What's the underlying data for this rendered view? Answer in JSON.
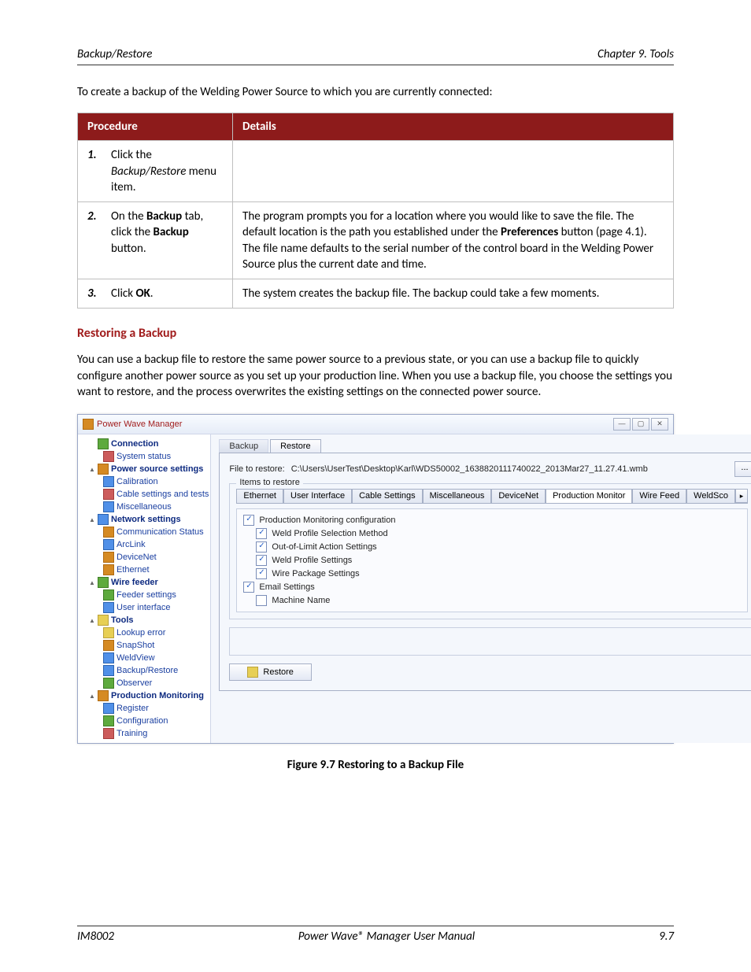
{
  "header": {
    "left": "Backup/Restore",
    "right": "Chapter 9. Tools"
  },
  "intro": "To create a backup of the Welding Power Source to which you are currently connected:",
  "table": {
    "col_procedure": "Procedure",
    "col_details": "Details",
    "rows": [
      {
        "num": "1.",
        "proc_parts": [
          "Click the ",
          "Backup/Restore",
          " menu item."
        ],
        "details": ""
      },
      {
        "num": "2.",
        "proc_parts": [
          "On the ",
          "Backup",
          " tab, click the ",
          "Backup",
          " button."
        ],
        "details_parts": [
          "The program prompts you for a location where you would like to save the file.  The default location is the path you established under the ",
          "Preferences",
          " button (page 4.1).  The file name defaults to the serial number of the control board in the Welding Power Source plus the current date and time."
        ]
      },
      {
        "num": "3.",
        "proc_parts": [
          "Click ",
          "OK",
          "."
        ],
        "details": "The system creates the backup file.  The backup could take a few moments."
      }
    ]
  },
  "h2": "Restoring a Backup",
  "para": "You can use a backup file to restore the same power source to a previous state, or you can use a backup file to quickly configure another power source as you set up your production line.  When you use a backup file, you choose the settings you want to restore, and the process overwrites the existing settings on the connected power source.",
  "figcap": "Figure 9.7    Restoring to a Backup File",
  "footer": {
    "left": "IM8002",
    "center": "Power Wave® Manager User Manual",
    "right": "9.7"
  },
  "app": {
    "title": "Power Wave Manager",
    "winbtns": {
      "min": "—",
      "max": "▢",
      "close": "✕"
    },
    "tree": [
      {
        "lvl": 0,
        "label": "Connection",
        "bold": true,
        "icon": "ico-green",
        "tri": ""
      },
      {
        "lvl": 1,
        "label": "System status",
        "icon": "ico-red"
      },
      {
        "lvl": 0,
        "label": "Power source settings",
        "bold": true,
        "icon": "ico-generic",
        "tri": "▲"
      },
      {
        "lvl": 1,
        "label": "Calibration",
        "icon": "ico-blue"
      },
      {
        "lvl": 1,
        "label": "Cable settings and tests",
        "icon": "ico-red"
      },
      {
        "lvl": 1,
        "label": "Miscellaneous",
        "icon": "ico-blue"
      },
      {
        "lvl": 0,
        "label": "Network settings",
        "bold": true,
        "icon": "ico-blue",
        "tri": "▲"
      },
      {
        "lvl": 1,
        "label": "Communication Status",
        "icon": "ico-generic"
      },
      {
        "lvl": 1,
        "label": "ArcLink",
        "icon": "ico-blue"
      },
      {
        "lvl": 1,
        "label": "DeviceNet",
        "icon": "ico-generic"
      },
      {
        "lvl": 1,
        "label": "Ethernet",
        "icon": "ico-generic"
      },
      {
        "lvl": 0,
        "label": "Wire feeder",
        "bold": true,
        "icon": "ico-green",
        "tri": "▲"
      },
      {
        "lvl": 1,
        "label": "Feeder settings",
        "icon": "ico-green"
      },
      {
        "lvl": 1,
        "label": "User interface",
        "icon": "ico-blue"
      },
      {
        "lvl": 0,
        "label": "Tools",
        "bold": true,
        "icon": "ico-yellow",
        "tri": "▲"
      },
      {
        "lvl": 1,
        "label": "Lookup error",
        "icon": "ico-yellow"
      },
      {
        "lvl": 1,
        "label": "SnapShot",
        "icon": "ico-generic"
      },
      {
        "lvl": 1,
        "label": "WeldView",
        "icon": "ico-blue"
      },
      {
        "lvl": 1,
        "label": "Backup/Restore",
        "icon": "ico-blue"
      },
      {
        "lvl": 1,
        "label": "Observer",
        "icon": "ico-green"
      },
      {
        "lvl": 0,
        "label": "Production Monitoring",
        "bold": true,
        "icon": "ico-generic",
        "tri": "▲"
      },
      {
        "lvl": 1,
        "label": "Register",
        "icon": "ico-blue"
      },
      {
        "lvl": 1,
        "label": "Configuration",
        "icon": "ico-green"
      },
      {
        "lvl": 1,
        "label": "Training",
        "icon": "ico-red"
      }
    ],
    "toptabs": {
      "inactive": "Backup",
      "active": "Restore"
    },
    "file_label": "File to restore:",
    "file_path": "C:\\Users\\UserTest\\Desktop\\Karl\\WDS50002_1638820111740022_2013Mar27_11.27.41.wmb",
    "dots": "...",
    "items_legend": "Items to restore",
    "subtabs": [
      "Ethernet",
      "User Interface",
      "Cable Settings",
      "Miscellaneous",
      "DeviceNet",
      "Production Monitor",
      "Wire Feed",
      "WeldSco"
    ],
    "active_subtab": 5,
    "checks": [
      {
        "label": "Production Monitoring configuration",
        "checked": true,
        "sub": false
      },
      {
        "label": "Weld Profile Selection Method",
        "checked": true,
        "sub": true
      },
      {
        "label": "Out-of-Limit Action Settings",
        "checked": true,
        "sub": true
      },
      {
        "label": "Weld Profile Settings",
        "checked": true,
        "sub": true
      },
      {
        "label": "Wire Package Settings",
        "checked": true,
        "sub": true
      },
      {
        "label": "Email Settings",
        "checked": true,
        "sub": false
      },
      {
        "label": "Machine Name",
        "checked": false,
        "sub": true
      }
    ],
    "restore_btn": "Restore"
  }
}
